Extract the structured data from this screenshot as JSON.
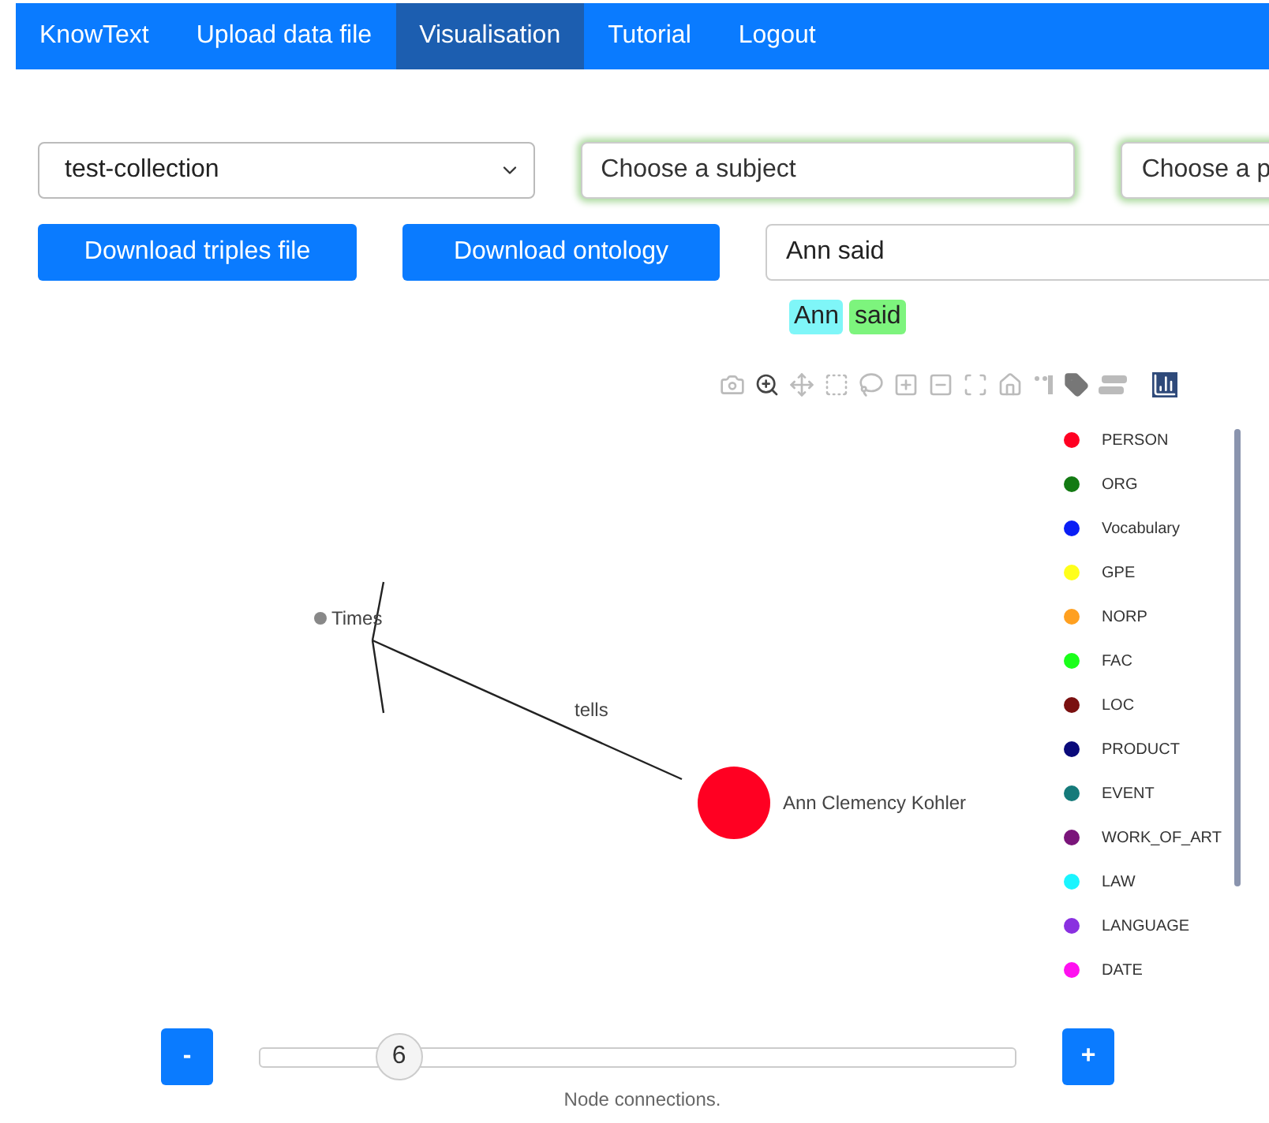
{
  "nav": [
    {
      "label": "KnowText",
      "selected": false
    },
    {
      "label": "Upload data file",
      "selected": false
    },
    {
      "label": "Visualisation",
      "selected": true
    },
    {
      "label": "Tutorial",
      "selected": false
    },
    {
      "label": "Logout",
      "selected": false
    }
  ],
  "collection_select": {
    "value": "test-collection"
  },
  "subject_field": {
    "placeholder": "Choose a subject"
  },
  "predicate_field": {
    "placeholder": "Choose a p"
  },
  "buttons": [
    "Download triples file",
    "Download ontology"
  ],
  "sentence_field": {
    "value": "Ann said"
  },
  "tokens": [
    {
      "text": "Ann",
      "color": "#7ff6f8"
    },
    {
      "text": "said",
      "color": "#7df47d"
    }
  ],
  "graph": {
    "nodes": [
      {
        "label": "Times",
        "color": "#888888",
        "kind": "small"
      },
      {
        "label": "Ann Clemency Kohler",
        "color": "#ff0022",
        "kind": "large"
      }
    ],
    "edges": [
      {
        "label": "tells"
      }
    ]
  },
  "legend": [
    {
      "label": "PERSON",
      "color": "#ff0022"
    },
    {
      "label": "ORG",
      "color": "#137a13"
    },
    {
      "label": "Vocabulary",
      "color": "#0a1ef5"
    },
    {
      "label": "GPE",
      "color": "#ffff1a"
    },
    {
      "label": "NORP",
      "color": "#ffa020"
    },
    {
      "label": "FAC",
      "color": "#1aff1a"
    },
    {
      "label": "LOC",
      "color": "#7a1010"
    },
    {
      "label": "PRODUCT",
      "color": "#0a0a7a"
    },
    {
      "label": "EVENT",
      "color": "#157a7a"
    },
    {
      "label": "WORK_OF_ART",
      "color": "#7a157a"
    },
    {
      "label": "LAW",
      "color": "#1af5ff"
    },
    {
      "label": "LANGUAGE",
      "color": "#8a30e0"
    },
    {
      "label": "DATE",
      "color": "#ff10f0"
    }
  ],
  "slider": {
    "minus": "-",
    "plus": "+",
    "value": "6",
    "level": 0.185,
    "caption": "Node connections."
  }
}
